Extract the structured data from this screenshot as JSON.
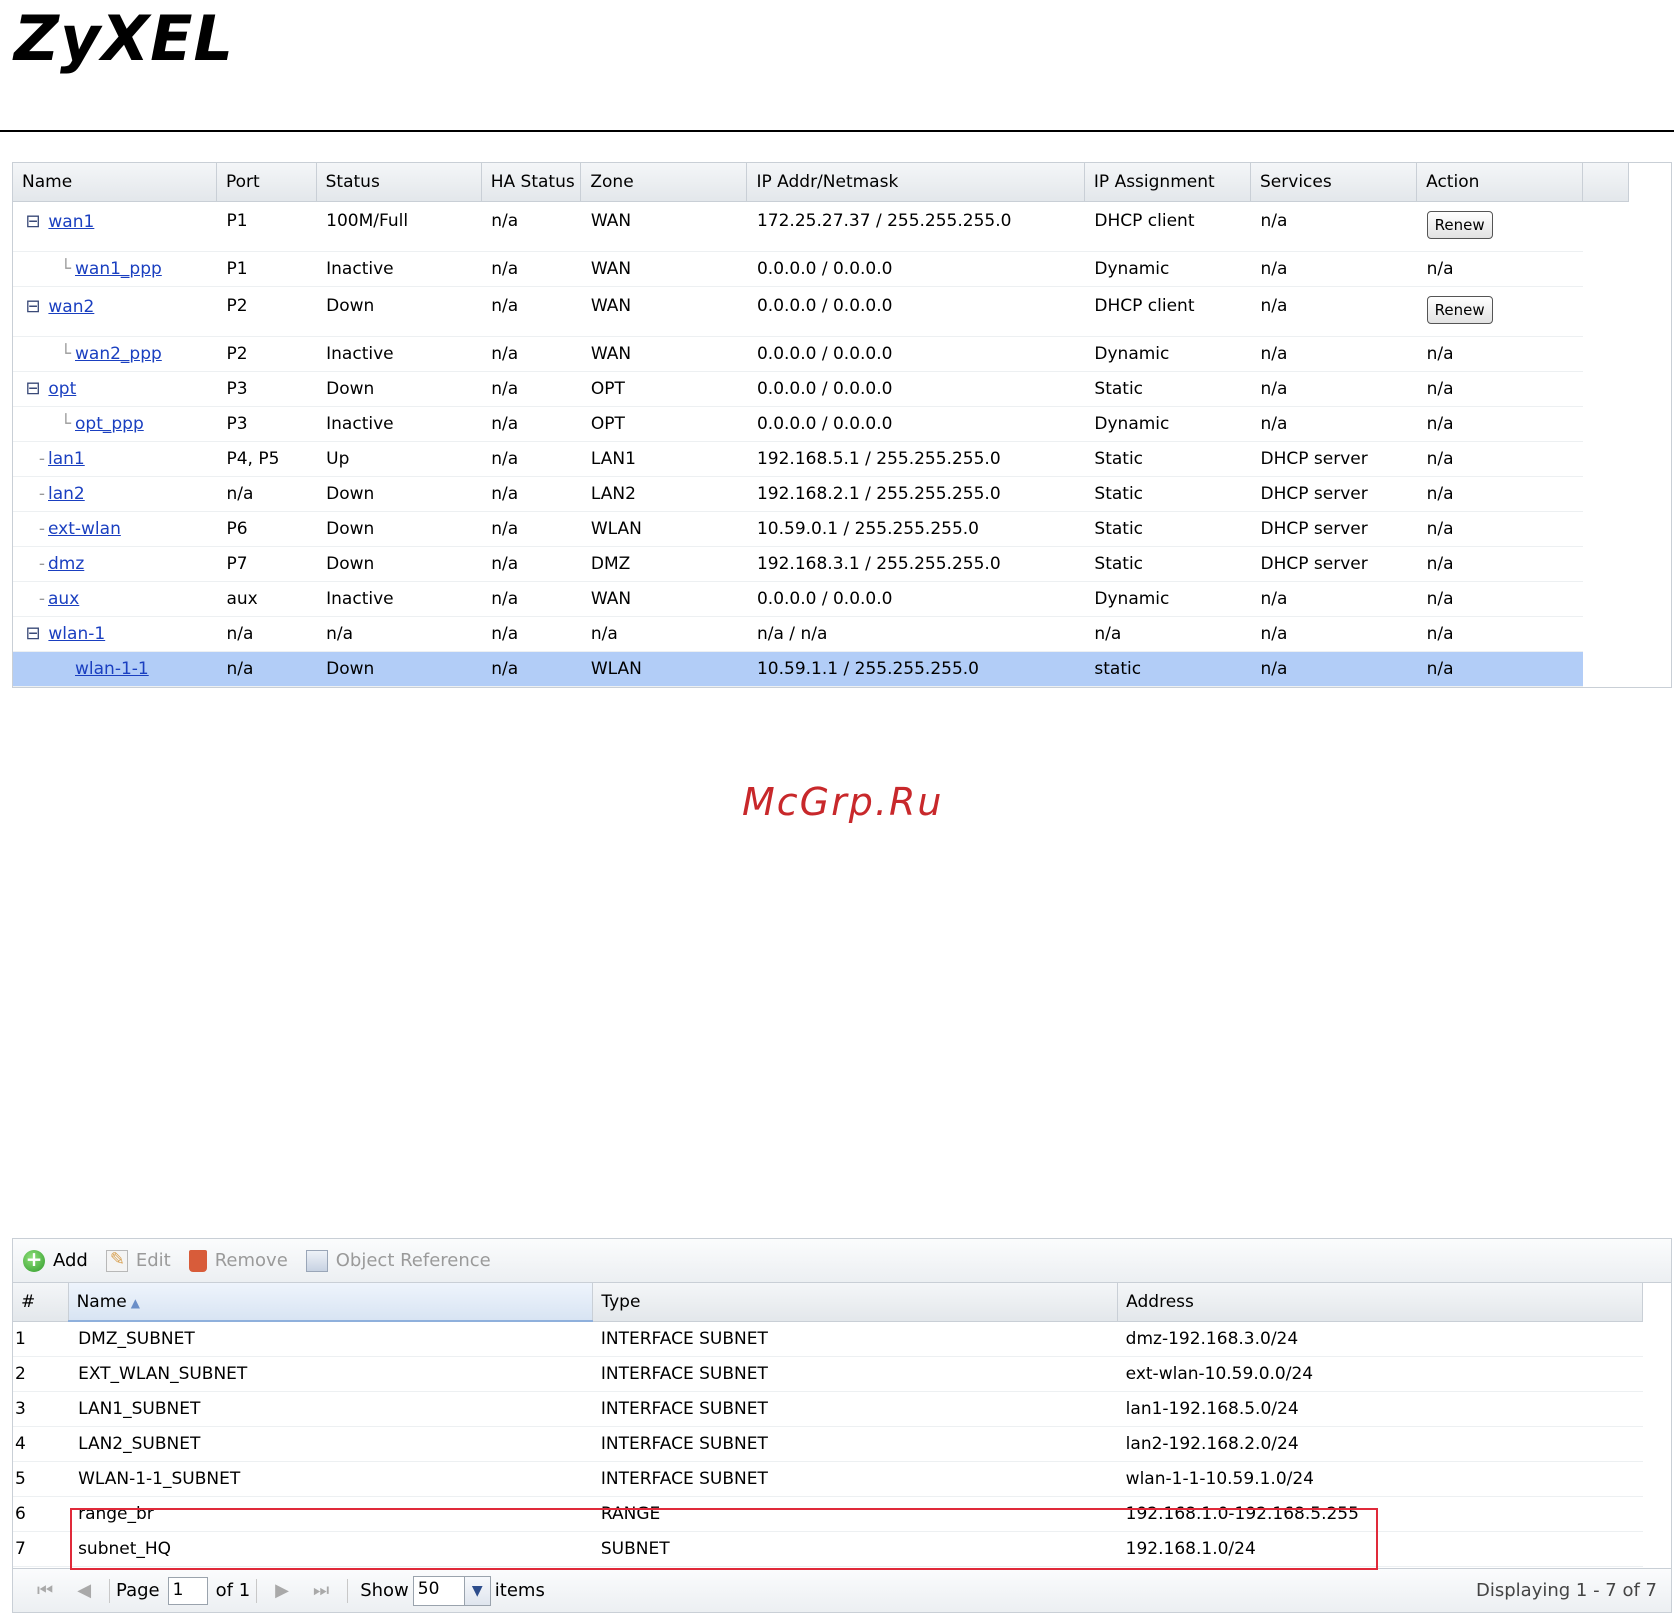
{
  "logo": "ZyXEL",
  "watermark": "McGrp.Ru",
  "interfaces": {
    "headers": [
      "Name",
      "Port",
      "Status",
      "HA Status",
      "Zone",
      "IP Addr/Netmask",
      "IP Assignment",
      "Services",
      "Action"
    ],
    "rows": [
      {
        "name": "wan1",
        "port": "P1",
        "status": "100M/Full",
        "ha": "n/a",
        "zone": "WAN",
        "ip": "172.25.27.37 / 255.255.255.0",
        "assign": "DHCP client",
        "services": "n/a",
        "action": "Renew"
      },
      {
        "name": "wan1_ppp",
        "port": "P1",
        "status": "Inactive",
        "ha": "n/a",
        "zone": "WAN",
        "ip": "0.0.0.0 / 0.0.0.0",
        "assign": "Dynamic",
        "services": "n/a",
        "action": "n/a"
      },
      {
        "name": "wan2",
        "port": "P2",
        "status": "Down",
        "ha": "n/a",
        "zone": "WAN",
        "ip": "0.0.0.0 / 0.0.0.0",
        "assign": "DHCP client",
        "services": "n/a",
        "action": "Renew"
      },
      {
        "name": "wan2_ppp",
        "port": "P2",
        "status": "Inactive",
        "ha": "n/a",
        "zone": "WAN",
        "ip": "0.0.0.0 / 0.0.0.0",
        "assign": "Dynamic",
        "services": "n/a",
        "action": "n/a"
      },
      {
        "name": "opt",
        "port": "P3",
        "status": "Down",
        "ha": "n/a",
        "zone": "OPT",
        "ip": "0.0.0.0 / 0.0.0.0",
        "assign": "Static",
        "services": "n/a",
        "action": "n/a"
      },
      {
        "name": "opt_ppp",
        "port": "P3",
        "status": "Inactive",
        "ha": "n/a",
        "zone": "OPT",
        "ip": "0.0.0.0 / 0.0.0.0",
        "assign": "Dynamic",
        "services": "n/a",
        "action": "n/a"
      },
      {
        "name": "lan1",
        "port": "P4, P5",
        "status": "Up",
        "ha": "n/a",
        "zone": "LAN1",
        "ip": "192.168.5.1 / 255.255.255.0",
        "assign": "Static",
        "services": "DHCP server",
        "action": "n/a"
      },
      {
        "name": "lan2",
        "port": "n/a",
        "status": "Down",
        "ha": "n/a",
        "zone": "LAN2",
        "ip": "192.168.2.1 / 255.255.255.0",
        "assign": "Static",
        "services": "DHCP server",
        "action": "n/a"
      },
      {
        "name": "ext-wlan",
        "port": "P6",
        "status": "Down",
        "ha": "n/a",
        "zone": "WLAN",
        "ip": "10.59.0.1 / 255.255.255.0",
        "assign": "Static",
        "services": "DHCP server",
        "action": "n/a"
      },
      {
        "name": "dmz",
        "port": "P7",
        "status": "Down",
        "ha": "n/a",
        "zone": "DMZ",
        "ip": "192.168.3.1 / 255.255.255.0",
        "assign": "Static",
        "services": "DHCP server",
        "action": "n/a"
      },
      {
        "name": "aux",
        "port": "aux",
        "status": "Inactive",
        "ha": "n/a",
        "zone": "WAN",
        "ip": "0.0.0.0 / 0.0.0.0",
        "assign": "Dynamic",
        "services": "n/a",
        "action": "n/a"
      },
      {
        "name": "wlan-1",
        "port": "n/a",
        "status": "n/a",
        "ha": "n/a",
        "zone": "n/a",
        "ip": "n/a / n/a",
        "assign": "n/a",
        "services": "n/a",
        "action": "n/a"
      },
      {
        "name": "wlan-1-1",
        "port": "n/a",
        "status": "Down",
        "ha": "n/a",
        "zone": "WLAN",
        "ip": "10.59.1.1 / 255.255.255.0",
        "assign": "static",
        "services": "n/a",
        "action": "n/a"
      }
    ]
  },
  "address_objects": {
    "toolbar": {
      "add": "Add",
      "edit": "Edit",
      "remove": "Remove",
      "object_reference": "Object Reference"
    },
    "headers": {
      "num": "#",
      "name": "Name",
      "type": "Type",
      "address": "Address"
    },
    "rows": [
      {
        "num": "1",
        "name": "DMZ_SUBNET",
        "type": "INTERFACE SUBNET",
        "address": "dmz-192.168.3.0/24"
      },
      {
        "num": "2",
        "name": "EXT_WLAN_SUBNET",
        "type": "INTERFACE SUBNET",
        "address": "ext-wlan-10.59.0.0/24"
      },
      {
        "num": "3",
        "name": "LAN1_SUBNET",
        "type": "INTERFACE SUBNET",
        "address": "lan1-192.168.5.0/24"
      },
      {
        "num": "4",
        "name": "LAN2_SUBNET",
        "type": "INTERFACE SUBNET",
        "address": "lan2-192.168.2.0/24"
      },
      {
        "num": "5",
        "name": "WLAN-1-1_SUBNET",
        "type": "INTERFACE SUBNET",
        "address": "wlan-1-1-10.59.1.0/24"
      },
      {
        "num": "6",
        "name": "range_br",
        "type": "RANGE",
        "address": "192.168.1.0-192.168.5.255"
      },
      {
        "num": "7",
        "name": "subnet_HQ",
        "type": "SUBNET",
        "address": "192.168.1.0/24"
      }
    ],
    "pager": {
      "page_label": "Page",
      "page_value": "1",
      "of_label": "of 1",
      "show_label": "Show",
      "show_value": "50",
      "items_label": "items",
      "displaying": "Displaying 1 - 7 of 7"
    }
  },
  "colors": {
    "link": "#1a3fc0",
    "selected_row": "#b2cdf7",
    "highlight_box": "#e02a3a",
    "watermark": "#c8282b"
  }
}
